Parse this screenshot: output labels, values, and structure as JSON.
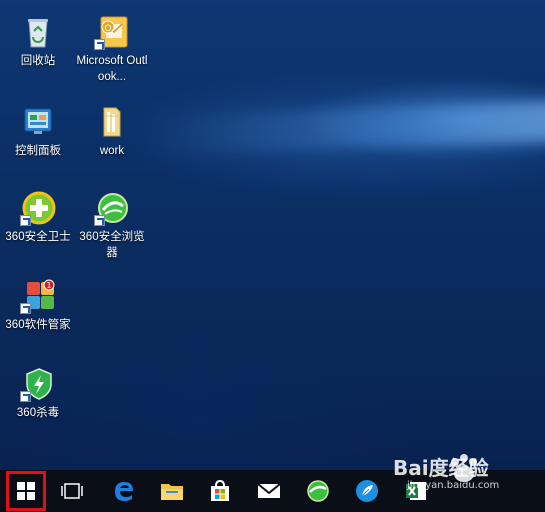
{
  "desktop": {
    "icons": [
      {
        "label": "回收站",
        "icon": "recycle-bin-icon"
      },
      {
        "label": "Microsoft Outlook...",
        "icon": "outlook-icon"
      },
      {
        "label": "控制面板",
        "icon": "control-panel-icon"
      },
      {
        "label": "work",
        "icon": "folder-icon"
      },
      {
        "label": "360安全卫士",
        "icon": "360-safeguard-icon"
      },
      {
        "label": "360安全浏览器",
        "icon": "360-browser-icon"
      },
      {
        "label": "360软件管家",
        "icon": "360-software-manager-icon"
      },
      {
        "label": "360杀毒",
        "icon": "360-antivirus-icon"
      }
    ]
  },
  "taskbar": {
    "items": [
      {
        "name": "start-button",
        "icon": "windows-logo-icon"
      },
      {
        "name": "task-view-button",
        "icon": "task-view-icon"
      },
      {
        "name": "edge-button",
        "icon": "edge-icon"
      },
      {
        "name": "file-explorer-button",
        "icon": "folder-icon"
      },
      {
        "name": "store-button",
        "icon": "store-icon"
      },
      {
        "name": "mail-button",
        "icon": "mail-icon"
      },
      {
        "name": "360-browser-button",
        "icon": "360-browser-icon"
      },
      {
        "name": "feather-app-button",
        "icon": "feather-icon"
      },
      {
        "name": "excel-button",
        "icon": "excel-icon"
      }
    ],
    "highlight_color": "#e0101a"
  },
  "watermark": {
    "brand": "Bai度经验",
    "url": "jingyan.baidu.com"
  }
}
